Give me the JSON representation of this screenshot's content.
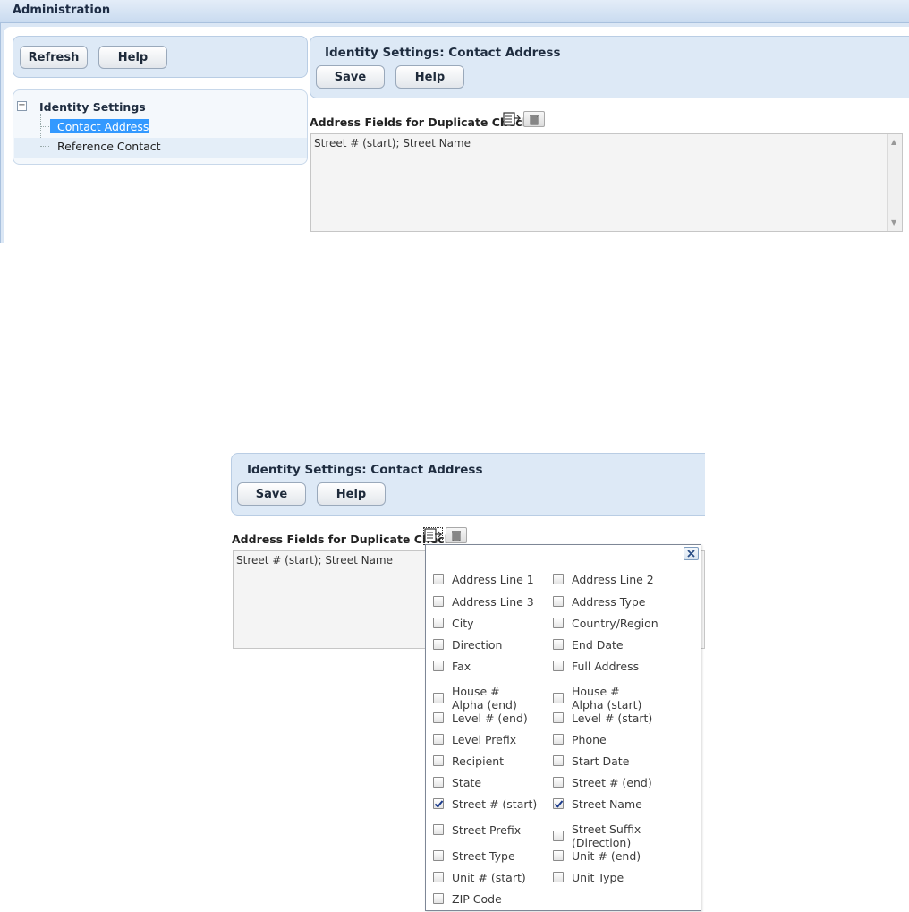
{
  "admin": {
    "title": "Administration",
    "refresh_label": "Refresh",
    "help_label": "Help",
    "tree": {
      "root_label": "Identity Settings",
      "items": [
        {
          "label": "Contact Address",
          "selected": true
        },
        {
          "label": "Reference Contact",
          "selected": false
        }
      ]
    }
  },
  "detail": {
    "header_title": "Identity Settings: Contact Address",
    "save_label": "Save",
    "help_label": "Help",
    "field_label": "Address Fields for Duplicate Check",
    "field_value": "Street # (start); Street Name"
  },
  "popup": {
    "close_icon": "close-icon",
    "options": [
      {
        "label": "Address Line 1",
        "checked": false
      },
      {
        "label": "Address Line 2",
        "checked": false
      },
      {
        "label": "Address Line 3",
        "checked": false
      },
      {
        "label": "Address Type",
        "checked": false
      },
      {
        "label": "City",
        "checked": false
      },
      {
        "label": "Country/Region",
        "checked": false
      },
      {
        "label": "Direction",
        "checked": false
      },
      {
        "label": "End Date",
        "checked": false
      },
      {
        "label": "Fax",
        "checked": false
      },
      {
        "label": "Full Address",
        "checked": false
      },
      {
        "label": "House # Alpha (end)",
        "checked": false
      },
      {
        "label": "House # Alpha (start)",
        "checked": false
      },
      {
        "label": "Level # (end)",
        "checked": false
      },
      {
        "label": "Level # (start)",
        "checked": false
      },
      {
        "label": "Level Prefix",
        "checked": false
      },
      {
        "label": "Phone",
        "checked": false
      },
      {
        "label": "Recipient",
        "checked": false
      },
      {
        "label": "Start Date",
        "checked": false
      },
      {
        "label": "State",
        "checked": false
      },
      {
        "label": "Street # (end)",
        "checked": false
      },
      {
        "label": "Street # (start)",
        "checked": true
      },
      {
        "label": "Street Name",
        "checked": true
      },
      {
        "label": "Street Prefix",
        "checked": false
      },
      {
        "label": "Street Suffix (Direction)",
        "checked": false
      },
      {
        "label": "Street Type",
        "checked": false
      },
      {
        "label": "Unit # (end)",
        "checked": false
      },
      {
        "label": "Unit # (start)",
        "checked": false
      },
      {
        "label": "Unit Type",
        "checked": false
      },
      {
        "label": "ZIP Code",
        "checked": false
      }
    ]
  }
}
